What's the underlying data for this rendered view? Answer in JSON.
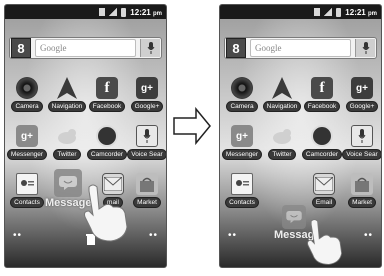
{
  "status_time": "12:21",
  "status_time_suffix": "pm",
  "search_placeholder": "Google",
  "search_logo": "8",
  "apps": {
    "camera": "Camera",
    "navigation": "Navigation",
    "facebook": "Facebook",
    "googleplus": "Google+",
    "messenger": "Messenger",
    "twitter": "Twitter",
    "camcorder": "Camcorder",
    "voice_search": "Voice Sear",
    "contacts": "Contacts",
    "email_left": "mail",
    "email_right": "Email",
    "market": "Market"
  },
  "icons": {
    "facebook_glyph": "f",
    "googleplus_glyph": "g+",
    "messenger_glyph": "g+"
  },
  "drag_label_left": "Message",
  "drag_label_right": "Messag",
  "page_dots": "••"
}
